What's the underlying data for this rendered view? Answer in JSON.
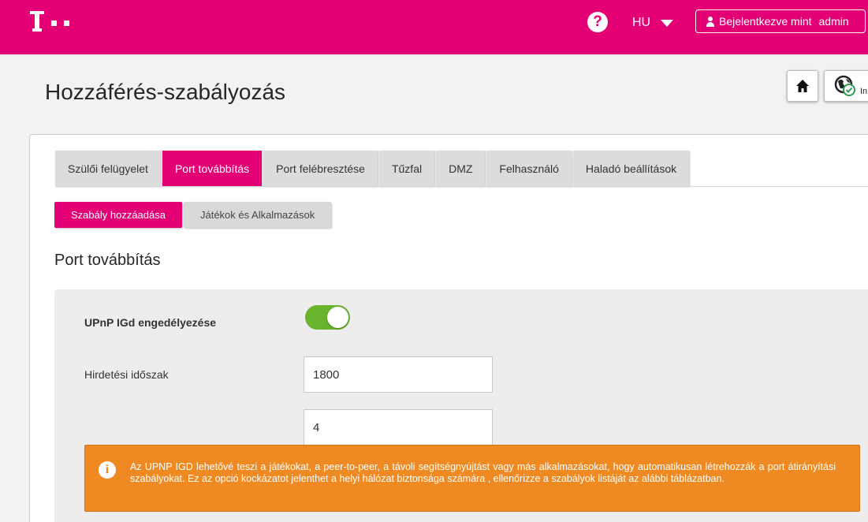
{
  "header": {
    "help_symbol": "?",
    "language": "HU",
    "login_prefix": "Bejelentkezve mint",
    "login_user": "admin",
    "brand_color": "#e20074"
  },
  "page": {
    "title": "Hozzáférés-szabályozás",
    "globe_button_label": "In"
  },
  "tabs": [
    {
      "label": "Szülői felügyelet",
      "active": false
    },
    {
      "label": "Port továbbítás",
      "active": true
    },
    {
      "label": "Port felébresztése",
      "active": false
    },
    {
      "label": "Tűzfal",
      "active": false
    },
    {
      "label": "DMZ",
      "active": false
    },
    {
      "label": "Felhasználó",
      "active": false
    },
    {
      "label": "Haladó beállítások",
      "active": false
    }
  ],
  "subtabs": [
    {
      "label": "Szabály hozzáadása",
      "active": true
    },
    {
      "label": "Játékok és Alkalmazások",
      "active": false
    }
  ],
  "section": {
    "title": "Port továbbítás"
  },
  "form": {
    "upnp_label": "UPnP IGd engedélyezése",
    "upnp_enabled": true,
    "toggle_color": "#6ab42d",
    "advertise_label": "Hirdetési időszak",
    "advertise_value": "1800",
    "second_value": "4"
  },
  "warning": {
    "color": "#ef8a23",
    "icon": "info-icon",
    "text": "Az UPNP IGD lehetővé teszi a játékokat, a peer-to-peer, a távoli segítségnyújtást vagy más alkalmazásokat, hogy automatikusan létrehozzák a port átirányítási szabályokat. Ez az opció kockázatot jelenthet a helyi hálózat biztonsága számára , ellenőrizze a szabályok listáját az alábbi táblázatban."
  }
}
